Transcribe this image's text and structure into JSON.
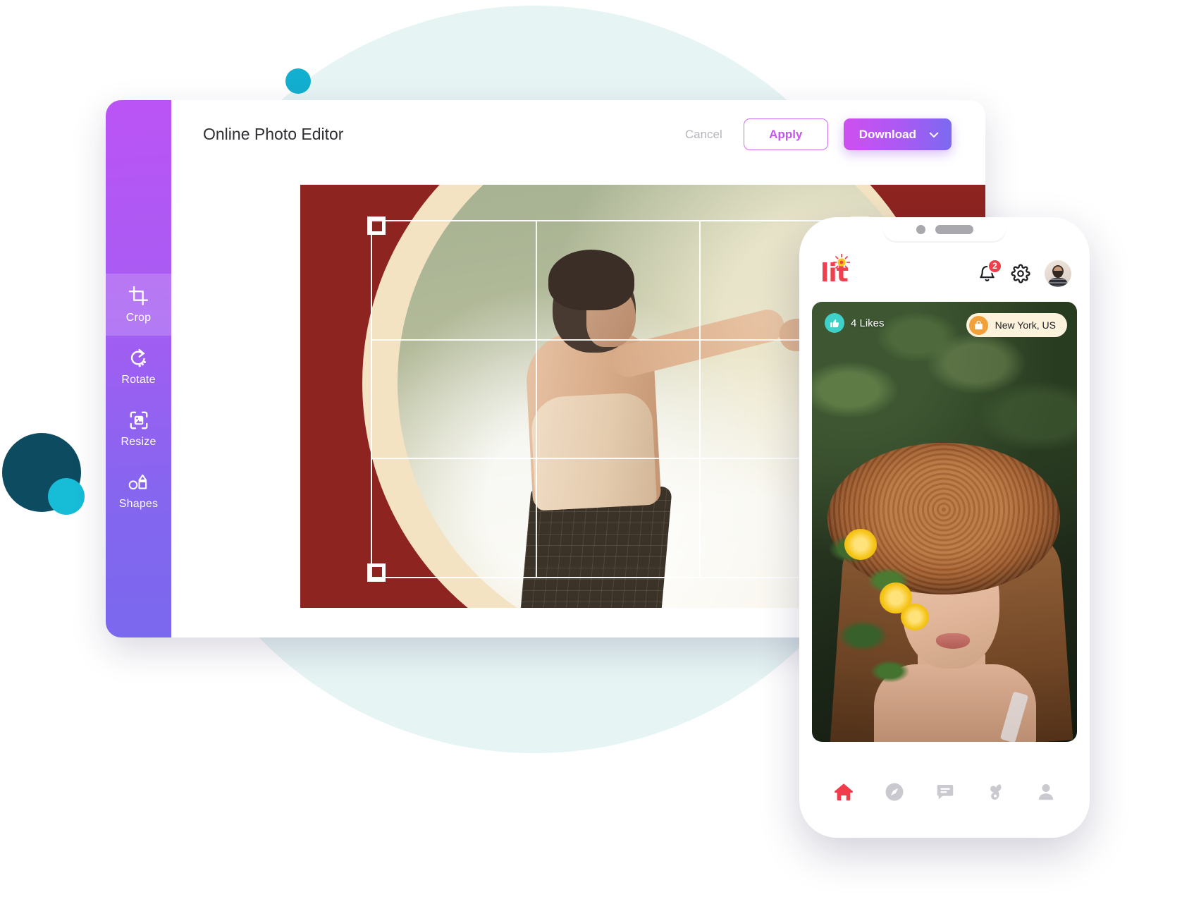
{
  "editor": {
    "title": "Online Photo Editor",
    "actions": {
      "cancel_label": "Cancel",
      "apply_label": "Apply",
      "download_label": "Download",
      "download_chevron_icon": "chevron-down-icon"
    },
    "tools": [
      {
        "label": "Crop",
        "icon": "crop-icon",
        "active": true
      },
      {
        "label": "Rotate",
        "icon": "rotate-icon",
        "active": false
      },
      {
        "label": "Resize",
        "icon": "resize-icon",
        "active": false
      },
      {
        "label": "Shapes",
        "icon": "shapes-icon",
        "active": false
      }
    ],
    "canvas": {
      "crop_overlay": "rule-of-thirds-grid",
      "handles": [
        "top-left",
        "top-right",
        "bottom-left",
        "bottom-right"
      ]
    }
  },
  "phone": {
    "app_name": "lit",
    "header": {
      "notifications_icon": "bell-icon",
      "notifications_count": "2",
      "settings_icon": "gear-icon",
      "avatar_icon": "avatar"
    },
    "post": {
      "likes_label": "4 Likes",
      "likes_icon": "thumbs-up-icon",
      "location_label": "New York, US",
      "location_icon": "bag-icon"
    },
    "tabbar": [
      {
        "icon": "home-icon",
        "active": true
      },
      {
        "icon": "compass-icon",
        "active": false
      },
      {
        "icon": "chat-icon",
        "active": false
      },
      {
        "icon": "activity-icon",
        "active": false
      },
      {
        "icon": "person-icon",
        "active": false
      }
    ]
  },
  "colors": {
    "brand_purple": "#a75cf2",
    "brand_pink": "#cf4ff0",
    "accent_red": "#ef4050",
    "teal_dot": "#0d4c60",
    "cyan_dot": "#17bcd6",
    "blob_mint": "#e6f4f4",
    "likes_teal": "#3fd0c9",
    "location_orange": "#f2a13a"
  }
}
